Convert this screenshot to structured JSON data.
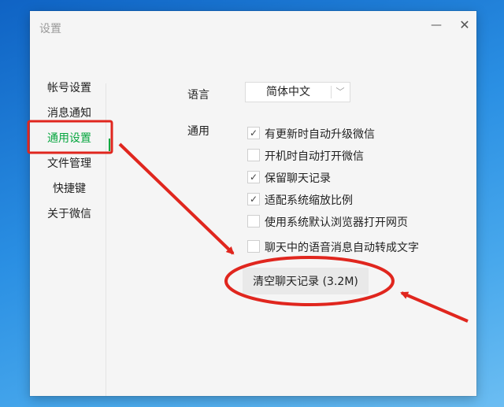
{
  "window": {
    "title": "设置",
    "min_icon": "—",
    "close_icon": "✕"
  },
  "nav": {
    "items": [
      {
        "label": "帐号设置",
        "active": false
      },
      {
        "label": "消息通知",
        "active": false
      },
      {
        "label": "通用设置",
        "active": true
      },
      {
        "label": "文件管理",
        "active": false
      },
      {
        "label": "快捷键",
        "active": false
      },
      {
        "label": "关于微信",
        "active": false
      }
    ]
  },
  "language": {
    "label": "语言",
    "value": "简体中文",
    "chevron_icon": "chevron-down-icon"
  },
  "general": {
    "label": "通用",
    "options": [
      {
        "label": "有更新时自动升级微信",
        "checked": true
      },
      {
        "label": "开机时自动打开微信",
        "checked": false
      },
      {
        "label": "保留聊天记录",
        "checked": true
      },
      {
        "label": "适配系统缩放比例",
        "checked": true
      },
      {
        "label": "使用系统默认浏览器打开网页",
        "checked": false
      },
      {
        "label": "聊天中的语音消息自动转成文字",
        "checked": false
      }
    ]
  },
  "clear_button": {
    "label": "清空聊天记录 (3.2M)"
  },
  "annotations": {
    "color": "#e0261e"
  }
}
